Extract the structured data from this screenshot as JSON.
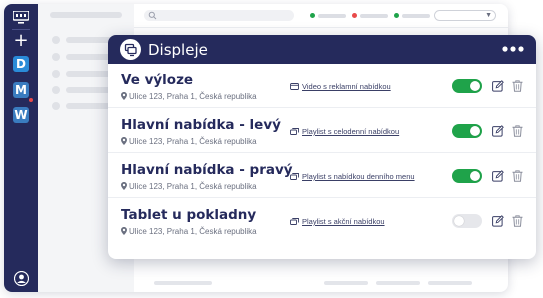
{
  "panel": {
    "title": "Displeje",
    "header_icon": "display-icon",
    "more_icon": "more-horizontal-icon"
  },
  "workspaces": [
    "D",
    "M",
    "W"
  ],
  "displays": [
    {
      "name": "Ve výloze",
      "address": "Ulice 123, Praha 1, Česká republika",
      "content_type": "video",
      "content_label": "Video s reklamní nabídkou",
      "enabled": true
    },
    {
      "name": "Hlavní nabídka - levý",
      "address": "Ulice 123, Praha 1, Česká republika",
      "content_type": "playlist",
      "content_label": "Playlist s celodenní nabídkou",
      "enabled": true
    },
    {
      "name": "Hlavní nabídka - pravý",
      "address": "Ulice 123, Praha 1, Česká republika",
      "content_type": "playlist",
      "content_label": "Playlist s nabídkou denního menu",
      "enabled": true
    },
    {
      "name": "Tablet u pokladny",
      "address": "Ulice 123, Praha 1, Česká republika",
      "content_type": "playlist",
      "content_label": "Playlist s akční nabídkou",
      "enabled": false
    }
  ],
  "colors": {
    "navy": "#252a5c",
    "toggle_on": "#1fa34a",
    "toggle_off": "#e6e7eb",
    "status_green": "#1fa34a",
    "status_red": "#e84a4a"
  }
}
